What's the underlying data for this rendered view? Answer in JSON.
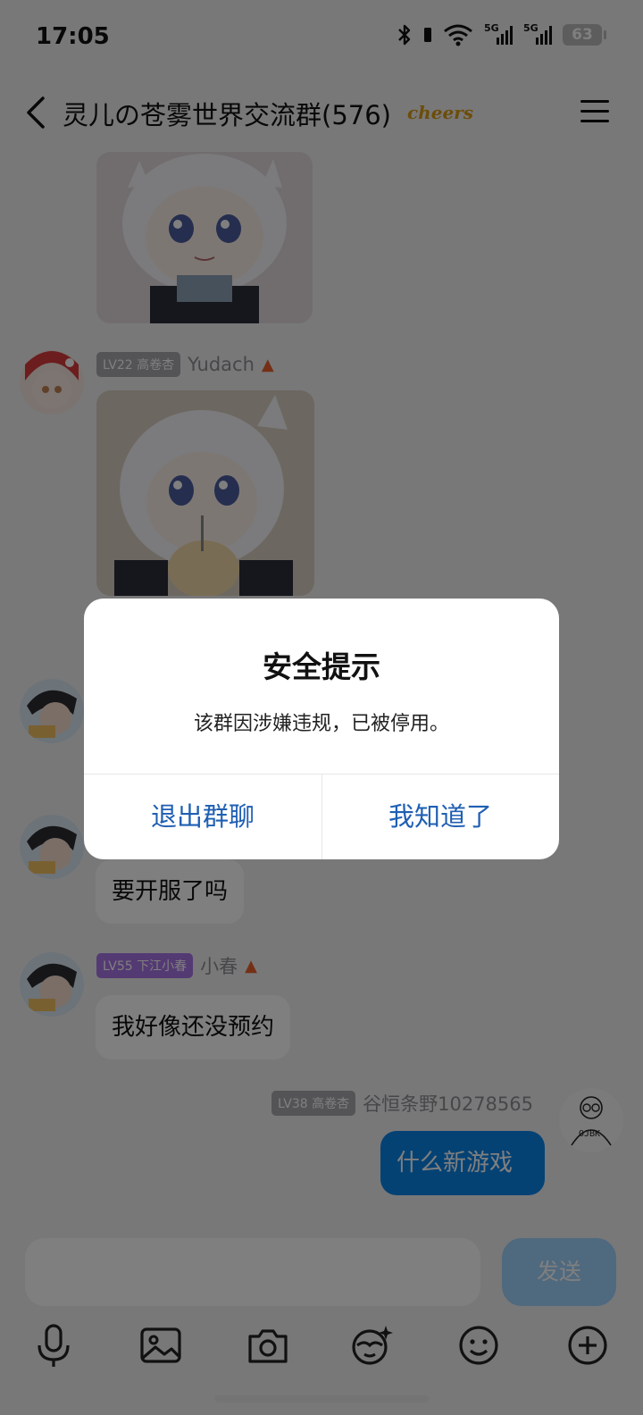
{
  "status_bar": {
    "time": "17:05",
    "battery": "63",
    "network_1": "5G",
    "network_2": "5G"
  },
  "header": {
    "title": "灵儿の苍雾世界交流群(576)",
    "badge": "cheers"
  },
  "messages": [
    {
      "level": "LV22 高卷杏",
      "nickname": "Yudach"
    },
    {
      "bubble_1": "要开服了吗"
    },
    {
      "level": "LV55 下江小春",
      "nickname": "小春",
      "bubble": "我好像还没预约"
    },
    {
      "level": "LV38 高卷杏",
      "nickname": "谷恒条野10278565",
      "bubble": "什么新游戏",
      "avatar_caption": "OJBK"
    }
  ],
  "input": {
    "placeholder": "",
    "send_label": "发送"
  },
  "toolbar": {
    "icons": [
      "mic-icon",
      "image-icon",
      "camera-icon",
      "sticker-icon",
      "emoji-icon",
      "plus-icon"
    ]
  },
  "dialog": {
    "title": "安全提示",
    "body": "该群因涉嫌违规，已被停用。",
    "button_exit": "退出群聊",
    "button_ok": "我知道了"
  },
  "colors": {
    "accent": "#0a84e8",
    "dialog_button": "#1f5fb3",
    "overlay": "#000000"
  }
}
